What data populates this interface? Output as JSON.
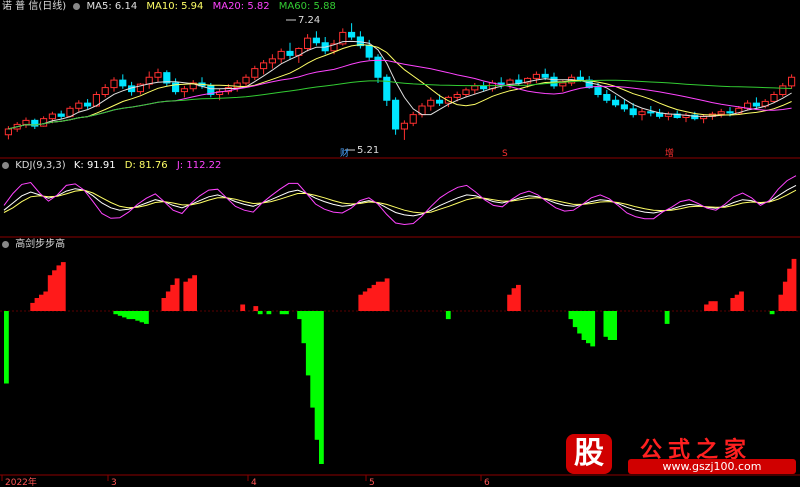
{
  "panel_main": {
    "title": "诺 普 信(日线)",
    "ma5_label": "MA5: 6.14",
    "ma10_label": "MA10: 5.94",
    "ma20_label": "MA20: 5.82",
    "ma60_label": "MA60: 5.88",
    "high_label": "7.24",
    "low_label": "5.21",
    "event_labels": [
      {
        "text": "财",
        "color": "#4aa3ff"
      },
      {
        "text": "S",
        "color": "#ff3030"
      },
      {
        "text": "增",
        "color": "#ff3030"
      }
    ],
    "colors": {
      "up": "#ff3030",
      "down": "#00e5ff",
      "ma5": "#e0e0e0",
      "ma10": "#ffff66",
      "ma20": "#ff44ff",
      "ma60": "#33cc33"
    }
  },
  "panel_kdj": {
    "title": "KDJ(9,3,3)",
    "k_label": "K: 91.91",
    "d_label": "D: 81.76",
    "j_label": "J: 112.22",
    "colors": {
      "k": "#ffffff",
      "d": "#ffff66",
      "j": "#ff44ff"
    }
  },
  "panel_indicator": {
    "title": "高剑步步高",
    "colors": {
      "pos": "#ff1a1a",
      "neg": "#00ff00"
    }
  },
  "axis": {
    "date_labels": [
      "2022年",
      "3",
      "4",
      "5",
      "6"
    ]
  },
  "watermark": {
    "logo_char": "股",
    "site_name": "公式之家",
    "url": "www.gszj100.com"
  },
  "chart_data": [
    {
      "type": "bar",
      "title": "",
      "note": "candlestick price panel (ohlc per bar)",
      "ylim": [
        5.0,
        7.4
      ],
      "ohlc": [
        [
          5.3,
          5.45,
          5.22,
          5.4
        ],
        [
          5.4,
          5.52,
          5.35,
          5.48
        ],
        [
          5.48,
          5.6,
          5.42,
          5.55
        ],
        [
          5.55,
          5.58,
          5.4,
          5.45
        ],
        [
          5.45,
          5.62,
          5.44,
          5.58
        ],
        [
          5.58,
          5.7,
          5.5,
          5.66
        ],
        [
          5.66,
          5.72,
          5.58,
          5.62
        ],
        [
          5.62,
          5.8,
          5.6,
          5.76
        ],
        [
          5.76,
          5.9,
          5.7,
          5.85
        ],
        [
          5.85,
          5.92,
          5.75,
          5.8
        ],
        [
          5.8,
          6.05,
          5.78,
          6.0
        ],
        [
          6.0,
          6.18,
          5.95,
          6.12
        ],
        [
          6.12,
          6.3,
          6.05,
          6.25
        ],
        [
          6.25,
          6.35,
          6.1,
          6.15
        ],
        [
          6.15,
          6.22,
          5.98,
          6.05
        ],
        [
          6.05,
          6.2,
          6.0,
          6.18
        ],
        [
          6.18,
          6.4,
          6.1,
          6.3
        ],
        [
          6.3,
          6.45,
          6.22,
          6.38
        ],
        [
          6.38,
          6.42,
          6.15,
          6.2
        ],
        [
          6.2,
          6.28,
          6.0,
          6.05
        ],
        [
          6.05,
          6.15,
          5.95,
          6.1
        ],
        [
          6.1,
          6.25,
          6.05,
          6.2
        ],
        [
          6.2,
          6.3,
          6.1,
          6.15
        ],
        [
          6.15,
          6.2,
          5.95,
          6.0
        ],
        [
          6.0,
          6.1,
          5.9,
          6.05
        ],
        [
          6.05,
          6.18,
          6.0,
          6.12
        ],
        [
          6.12,
          6.25,
          6.05,
          6.2
        ],
        [
          6.2,
          6.35,
          6.15,
          6.3
        ],
        [
          6.3,
          6.5,
          6.25,
          6.45
        ],
        [
          6.45,
          6.6,
          6.35,
          6.55
        ],
        [
          6.55,
          6.7,
          6.45,
          6.62
        ],
        [
          6.62,
          6.8,
          6.55,
          6.75
        ],
        [
          6.75,
          6.9,
          6.6,
          6.68
        ],
        [
          6.68,
          6.82,
          6.55,
          6.8
        ],
        [
          6.8,
          7.05,
          6.75,
          6.98
        ],
        [
          6.98,
          7.1,
          6.85,
          6.9
        ],
        [
          6.9,
          7.0,
          6.7,
          6.76
        ],
        [
          6.76,
          6.95,
          6.7,
          6.88
        ],
        [
          6.88,
          7.15,
          6.85,
          7.08
        ],
        [
          7.08,
          7.24,
          6.95,
          7.0
        ],
        [
          7.0,
          7.1,
          6.8,
          6.85
        ],
        [
          6.85,
          6.95,
          6.6,
          6.65
        ],
        [
          6.65,
          6.7,
          6.2,
          6.3
        ],
        [
          6.3,
          6.35,
          5.8,
          5.9
        ],
        [
          5.9,
          5.95,
          5.3,
          5.4
        ],
        [
          5.4,
          5.55,
          5.21,
          5.5
        ],
        [
          5.5,
          5.7,
          5.45,
          5.65
        ],
        [
          5.65,
          5.85,
          5.6,
          5.8
        ],
        [
          5.8,
          5.95,
          5.72,
          5.9
        ],
        [
          5.9,
          6.0,
          5.8,
          5.85
        ],
        [
          5.85,
          5.98,
          5.78,
          5.95
        ],
        [
          5.95,
          6.05,
          5.88,
          6.0
        ],
        [
          6.0,
          6.12,
          5.95,
          6.08
        ],
        [
          6.08,
          6.2,
          6.0,
          6.15
        ],
        [
          6.15,
          6.22,
          6.05,
          6.1
        ],
        [
          6.1,
          6.25,
          6.05,
          6.2
        ],
        [
          6.2,
          6.3,
          6.1,
          6.18
        ],
        [
          6.18,
          6.28,
          6.1,
          6.25
        ],
        [
          6.25,
          6.35,
          6.15,
          6.2
        ],
        [
          6.2,
          6.3,
          6.12,
          6.28
        ],
        [
          6.28,
          6.4,
          6.2,
          6.35
        ],
        [
          6.35,
          6.45,
          6.25,
          6.3
        ],
        [
          6.3,
          6.38,
          6.1,
          6.15
        ],
        [
          6.15,
          6.25,
          6.05,
          6.2
        ],
        [
          6.2,
          6.35,
          6.15,
          6.3
        ],
        [
          6.3,
          6.42,
          6.22,
          6.25
        ],
        [
          6.25,
          6.32,
          6.1,
          6.12
        ],
        [
          6.12,
          6.2,
          5.95,
          6.0
        ],
        [
          6.0,
          6.08,
          5.85,
          5.9
        ],
        [
          5.9,
          5.98,
          5.78,
          5.82
        ],
        [
          5.82,
          5.92,
          5.7,
          5.75
        ],
        [
          5.75,
          5.85,
          5.6,
          5.65
        ],
        [
          5.65,
          5.75,
          5.55,
          5.7
        ],
        [
          5.7,
          5.8,
          5.62,
          5.68
        ],
        [
          5.68,
          5.75,
          5.58,
          5.62
        ],
        [
          5.62,
          5.7,
          5.55,
          5.66
        ],
        [
          5.66,
          5.72,
          5.58,
          5.6
        ],
        [
          5.6,
          5.68,
          5.52,
          5.64
        ],
        [
          5.64,
          5.7,
          5.55,
          5.58
        ],
        [
          5.58,
          5.66,
          5.5,
          5.62
        ],
        [
          5.62,
          5.7,
          5.56,
          5.66
        ],
        [
          5.66,
          5.75,
          5.6,
          5.7
        ],
        [
          5.7,
          5.78,
          5.62,
          5.68
        ],
        [
          5.68,
          5.8,
          5.65,
          5.76
        ],
        [
          5.76,
          5.9,
          5.72,
          5.85
        ],
        [
          5.85,
          5.95,
          5.75,
          5.8
        ],
        [
          5.8,
          5.92,
          5.76,
          5.88
        ],
        [
          5.88,
          6.05,
          5.85,
          6.0
        ],
        [
          6.0,
          6.2,
          5.96,
          6.15
        ],
        [
          6.15,
          6.35,
          6.1,
          6.3
        ]
      ]
    },
    {
      "type": "line",
      "title": "",
      "ylim": [
        -10,
        120
      ],
      "series": [
        {
          "name": "K",
          "values": [
            40,
            55,
            70,
            78,
            72,
            65,
            70,
            80,
            85,
            82,
            70,
            55,
            45,
            40,
            42,
            48,
            55,
            62,
            58,
            50,
            45,
            52,
            60,
            68,
            72,
            66,
            58,
            52,
            48,
            55,
            62,
            70,
            78,
            82,
            75,
            65,
            58,
            52,
            48,
            50,
            56,
            60,
            55,
            45,
            35,
            30,
            28,
            32,
            40,
            50,
            58,
            66,
            72,
            70,
            64,
            58,
            55,
            60,
            66,
            70,
            68,
            62,
            55,
            50,
            48,
            52,
            58,
            62,
            60,
            54,
            46,
            40,
            36,
            34,
            38,
            42,
            48,
            52,
            50,
            46,
            44,
            48,
            56,
            62,
            60,
            54,
            58,
            70,
            82,
            91.91
          ]
        },
        {
          "name": "D",
          "values": [
            35,
            45,
            58,
            68,
            70,
            68,
            69,
            74,
            80,
            82,
            76,
            66,
            56,
            48,
            45,
            46,
            50,
            56,
            58,
            55,
            51,
            51,
            55,
            61,
            66,
            66,
            63,
            58,
            54,
            55,
            58,
            63,
            69,
            75,
            75,
            71,
            66,
            60,
            55,
            53,
            54,
            57,
            56,
            52,
            46,
            40,
            36,
            34,
            36,
            42,
            48,
            55,
            62,
            66,
            65,
            62,
            59,
            59,
            62,
            65,
            66,
            64,
            60,
            56,
            52,
            52,
            54,
            57,
            58,
            56,
            52,
            47,
            43,
            40,
            39,
            40,
            43,
            47,
            48,
            47,
            46,
            46,
            50,
            55,
            57,
            56,
            57,
            63,
            72,
            81.76
          ]
        },
        {
          "name": "J",
          "values": [
            50,
            75,
            94,
            98,
            76,
            59,
            72,
            92,
            95,
            82,
            58,
            33,
            23,
            24,
            36,
            52,
            65,
            74,
            58,
            40,
            33,
            54,
            70,
            82,
            84,
            66,
            48,
            40,
            36,
            55,
            70,
            84,
            96,
            96,
            75,
            53,
            42,
            36,
            34,
            44,
            60,
            66,
            53,
            31,
            13,
            10,
            12,
            28,
            48,
            66,
            78,
            88,
            92,
            78,
            62,
            50,
            47,
            62,
            74,
            80,
            72,
            58,
            45,
            38,
            40,
            52,
            66,
            72,
            64,
            50,
            34,
            26,
            22,
            22,
            36,
            46,
            58,
            62,
            54,
            44,
            40,
            52,
            68,
            76,
            66,
            50,
            60,
            84,
            102,
            112.22
          ]
        }
      ]
    },
    {
      "type": "bar",
      "title": "",
      "ylim": [
        -100,
        35
      ],
      "values": [
        -45,
        0,
        0,
        0,
        0,
        0,
        5,
        8,
        10,
        12,
        22,
        25,
        28,
        30,
        0,
        0,
        0,
        0,
        0,
        0,
        0,
        0,
        0,
        0,
        0,
        -2,
        -3,
        -4,
        -5,
        -5,
        -6,
        -7,
        -8,
        0,
        0,
        0,
        8,
        12,
        16,
        20,
        0,
        18,
        20,
        22,
        0,
        0,
        0,
        0,
        0,
        0,
        0,
        0,
        0,
        0,
        4,
        0,
        0,
        3,
        -2,
        0,
        -2,
        0,
        0,
        -2,
        -2,
        0,
        0,
        -5,
        -20,
        -40,
        -60,
        -80,
        -95,
        0,
        0,
        0,
        0,
        0,
        0,
        0,
        0,
        10,
        12,
        14,
        16,
        18,
        18,
        20,
        0,
        0,
        0,
        0,
        0,
        0,
        0,
        0,
        0,
        0,
        0,
        0,
        0,
        -5,
        0,
        0,
        0,
        0,
        0,
        0,
        0,
        0,
        0,
        0,
        0,
        0,
        0,
        10,
        14,
        16,
        0,
        0,
        0,
        0,
        0,
        0,
        0,
        0,
        0,
        0,
        0,
        -5,
        -10,
        -14,
        -18,
        -20,
        -22,
        0,
        0,
        -16,
        -18,
        -18,
        0,
        0,
        0,
        0,
        0,
        0,
        0,
        0,
        0,
        0,
        0,
        -8,
        0,
        0,
        0,
        0,
        0,
        0,
        0,
        0,
        4,
        6,
        6,
        0,
        0,
        0,
        8,
        10,
        12,
        0,
        0,
        0,
        0,
        0,
        0,
        -2,
        0,
        10,
        18,
        26,
        32
      ]
    }
  ]
}
